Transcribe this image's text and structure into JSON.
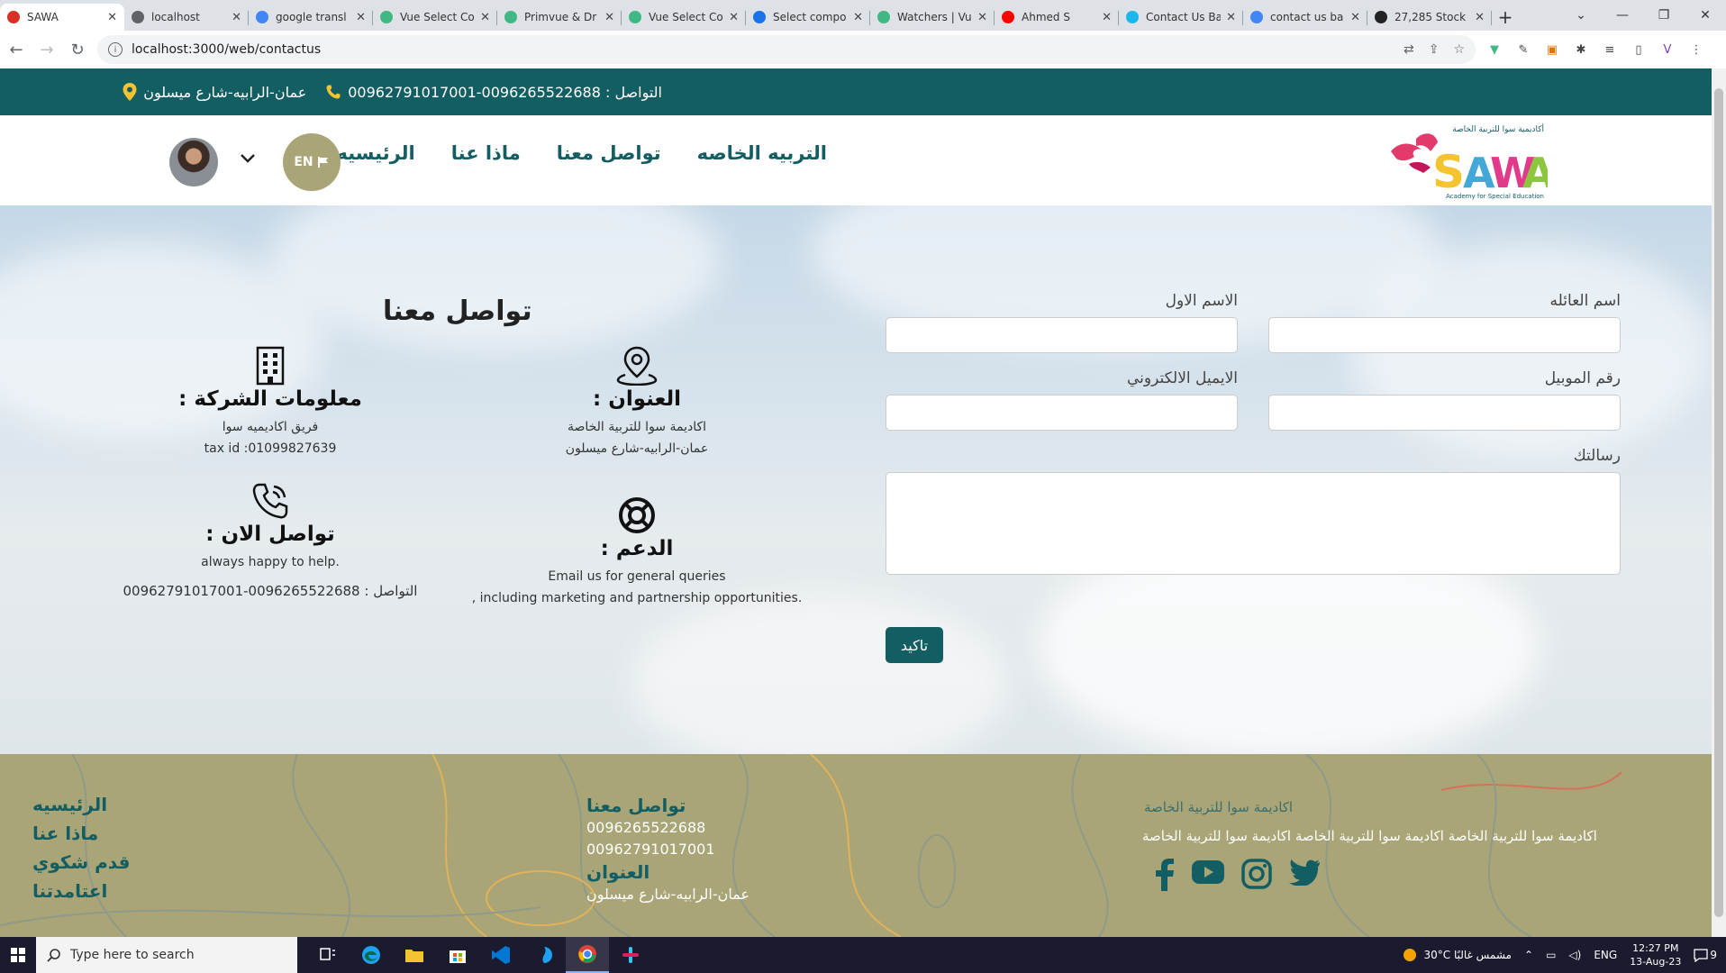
{
  "browser": {
    "tabs": [
      {
        "title": "SAWA",
        "active": true,
        "color": "#d93025"
      },
      {
        "title": "localhost",
        "color": "#5f6368"
      },
      {
        "title": "google transl",
        "color": "#4285f4"
      },
      {
        "title": "Vue Select Co",
        "color": "#41b883"
      },
      {
        "title": "Primvue & Dr",
        "color": "#41b883"
      },
      {
        "title": "Vue Select Co",
        "color": "#41b883"
      },
      {
        "title": "Select compo",
        "color": "#1a73e8"
      },
      {
        "title": "Watchers | Vu",
        "color": "#41b883"
      },
      {
        "title": "Ahmed S",
        "color": "#ff0000"
      },
      {
        "title": "Contact Us Ba",
        "color": "#1ab7ea"
      },
      {
        "title": "contact us ba",
        "color": "#4285f4"
      },
      {
        "title": "27,285 Stock",
        "color": "#222"
      }
    ],
    "url": "localhost:3000/web/contactus"
  },
  "topbar": {
    "address": "عمان-الرابيه-شارع ميسلون",
    "phone": "التواصل : 0096265522688-00962791017001"
  },
  "header": {
    "logo_text": "SAWA",
    "logo_arabic": "أكاديمية سوا للتربية الخاصة",
    "logo_sub": "Academy for Special Education",
    "nav": [
      "التربيه الخاصه",
      "تواصل معنا",
      "ماذا عنا",
      "الرئيسيه"
    ],
    "lang": "EN"
  },
  "contact": {
    "title": "تواصل معنا",
    "company": {
      "heading": ": معلومات الشركة",
      "line1": "فريق اكاديميه سوا",
      "line2": "tax id :01099827639"
    },
    "address": {
      "heading": ": العنوان",
      "line1": "اكاديمة سوا للتربية الخاصة",
      "line2": "عمان-الرابيه-شارع ميسلون"
    },
    "now": {
      "heading": ": تواصل الان",
      "line1": "always happy to help.",
      "line2": "التواصل : 0096265522688-00962791017001"
    },
    "support": {
      "heading": ": الدعم",
      "line1": "Email us for general queries",
      "line2": ", including marketing and partnership opportunities."
    }
  },
  "form": {
    "family_name": "اسم العائله",
    "first_name": "الاسم الاول",
    "mobile": "رقم الموبيل",
    "email": "الايميل الالكتروني",
    "message": "رسالتك",
    "submit": "تاكيد"
  },
  "footer": {
    "nav": [
      "الرئيسيه",
      "ماذا عنا",
      "قدم شكوي",
      "اعتامدتنا"
    ],
    "contact_heading": "تواصل معنا",
    "phone1": "0096265522688",
    "phone2": "00962791017001",
    "address_heading": "العنوان",
    "address": "عمان-الرابيه-شارع ميسلون",
    "about_title": "اكاديمة سوا للتربية الخاصة",
    "about_text": "اكاديمة سوا للتربية الخاصة اكاديمة سوا للتربية الخاصة اكاديمة سوا للتربية الخاصة"
  },
  "taskbar": {
    "search_placeholder": "Type here to search",
    "weather": "30°C  مشمس غالبًا",
    "lang": "ENG",
    "time": "12:27 PM",
    "date": "13-Aug-23",
    "notifications": "9"
  }
}
